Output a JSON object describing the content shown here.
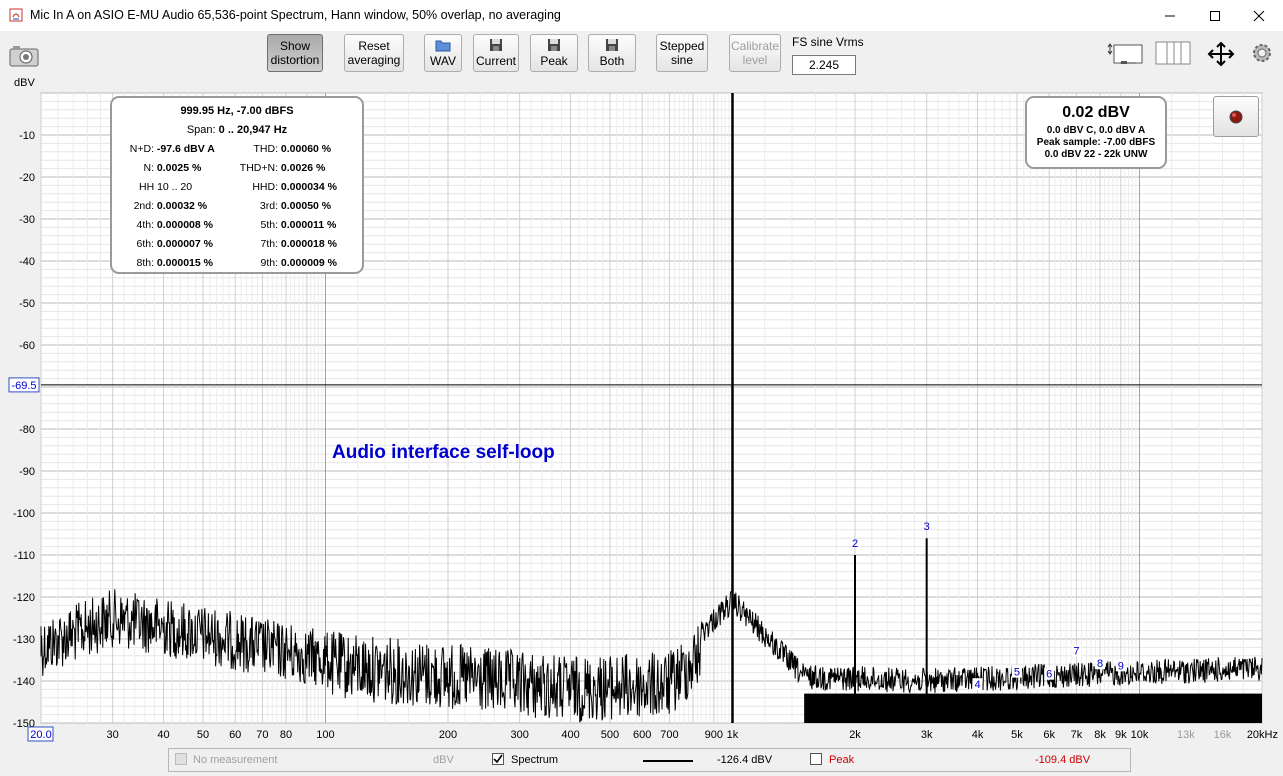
{
  "window": {
    "title": "Mic In A on ASIO E-MU Audio 65,536-point Spectrum, Hann window, 50% overlap, no averaging"
  },
  "toolbar": {
    "show_distortion": [
      "Show",
      "distortion"
    ],
    "reset_averaging": [
      "Reset",
      "averaging"
    ],
    "wav": "WAV",
    "current": "Current",
    "peak": "Peak",
    "both": "Both",
    "stepped_sine": [
      "Stepped",
      "sine"
    ],
    "calibrate_level": [
      "Calibrate",
      "level"
    ],
    "fs_label": "FS sine Vrms",
    "fs_value": "2.245"
  },
  "distortion": {
    "freq_line": "999.95 Hz, -7.00 dBFS",
    "span_label": "Span:",
    "span_value": "0 .. 20,947 Hz",
    "nd_label": "N+D:",
    "nd_value": "-97.6 dBV A",
    "thd_label": "THD:",
    "thd_value": "0.00060 %",
    "n_label": "N:",
    "n_value": "0.0025 %",
    "thdn_label": "THD+N:",
    "thdn_value": "0.0026 %",
    "hh_label": "HH 10 .. 20",
    "hhd_label": "HHD:",
    "hhd_value": "0.000034 %",
    "h2_label": "2nd:",
    "h2_value": "0.00032 %",
    "h3_label": "3rd:",
    "h3_value": "0.00050 %",
    "h4_label": "4th:",
    "h4_value": "0.000008 %",
    "h5_label": "5th:",
    "h5_value": "0.000011 %",
    "h6_label": "6th:",
    "h6_value": "0.000007 %",
    "h7_label": "7th:",
    "h7_value": "0.000018 %",
    "h8_label": "8th:",
    "h8_value": "0.000015 %",
    "h9_label": "9th:",
    "h9_value": "0.000009 %"
  },
  "level": {
    "main": "0.02 dBV",
    "line1": "0.0 dBV C, 0.0 dBV A",
    "line2": "Peak sample: -7.00 dBFS",
    "line3": "0.0 dBV 22 - 22k UNW"
  },
  "legend": {
    "no_measurement": "No measurement",
    "unit": "dBV",
    "spectrum": "Spectrum",
    "spectrum_value": "-126.4 dBV",
    "peak": "Peak",
    "peak_value": "-109.4 dBV"
  },
  "colors": {
    "trace": "#000000",
    "annotation": "#0000cc",
    "peak_text": "#cc0000"
  },
  "chart_data": {
    "type": "line",
    "ylabel": "dBV",
    "ylim": [
      -150,
      0
    ],
    "xlim": [
      20,
      20000
    ],
    "x_scale": "log",
    "y_ticks": [
      "-10",
      "-20",
      "-30",
      "-40",
      "-50",
      "-60",
      "-80",
      "-90",
      "-100",
      "-110",
      "-120",
      "-130",
      "-140",
      "-150"
    ],
    "y_cursor": "-69.5",
    "x_start_label": "20.0",
    "x_ticks": [
      {
        "f": 30,
        "label": "30"
      },
      {
        "f": 40,
        "label": "40"
      },
      {
        "f": 50,
        "label": "50"
      },
      {
        "f": 60,
        "label": "60"
      },
      {
        "f": 70,
        "label": "70"
      },
      {
        "f": 80,
        "label": "80"
      },
      {
        "f": 100,
        "label": "100"
      },
      {
        "f": 200,
        "label": "200"
      },
      {
        "f": 300,
        "label": "300"
      },
      {
        "f": 400,
        "label": "400"
      },
      {
        "f": 500,
        "label": "500"
      },
      {
        "f": 600,
        "label": "600"
      },
      {
        "f": 700,
        "label": "700"
      },
      {
        "f": 900,
        "label": "900"
      },
      {
        "f": 1000,
        "label": "1k"
      },
      {
        "f": 2000,
        "label": "2k"
      },
      {
        "f": 3000,
        "label": "3k"
      },
      {
        "f": 4000,
        "label": "4k"
      },
      {
        "f": 5000,
        "label": "5k"
      },
      {
        "f": 6000,
        "label": "6k"
      },
      {
        "f": 7000,
        "label": "7k"
      },
      {
        "f": 8000,
        "label": "8k"
      },
      {
        "f": 9000,
        "label": "9k"
      },
      {
        "f": 10000,
        "label": "10k"
      },
      {
        "f": 13000,
        "label": "13k"
      },
      {
        "f": 16000,
        "label": "16k"
      },
      {
        "f": 20000,
        "label": "20kHz"
      }
    ],
    "annotation": "Audio interface self-loop",
    "fundamental": {
      "f": 1000,
      "db": 0
    },
    "harmonics": [
      {
        "n": "2",
        "f": 2000,
        "db": -110
      },
      {
        "n": "3",
        "f": 3000,
        "db": -106
      },
      {
        "n": "4",
        "f": 4000,
        "db": -141
      },
      {
        "n": "5",
        "f": 5000,
        "db": -138
      },
      {
        "n": "6",
        "f": 6000,
        "db": -138.5
      },
      {
        "n": "7",
        "f": 7000,
        "db": -133
      },
      {
        "n": "8",
        "f": 8000,
        "db": -136
      },
      {
        "n": "9",
        "f": 9000,
        "db": -136.5
      }
    ],
    "noise_floor_envelope": [
      {
        "f": 20,
        "db": -125
      },
      {
        "f": 30,
        "db": -118
      },
      {
        "f": 50,
        "db": -122
      },
      {
        "f": 100,
        "db": -128
      },
      {
        "f": 200,
        "db": -131
      },
      {
        "f": 400,
        "db": -134
      },
      {
        "f": 700,
        "db": -133
      },
      {
        "f": 1000,
        "db": -118
      },
      {
        "f": 1500,
        "db": -136
      },
      {
        "f": 3000,
        "db": -137
      },
      {
        "f": 10000,
        "db": -135
      },
      {
        "f": 20000,
        "db": -134
      }
    ]
  }
}
